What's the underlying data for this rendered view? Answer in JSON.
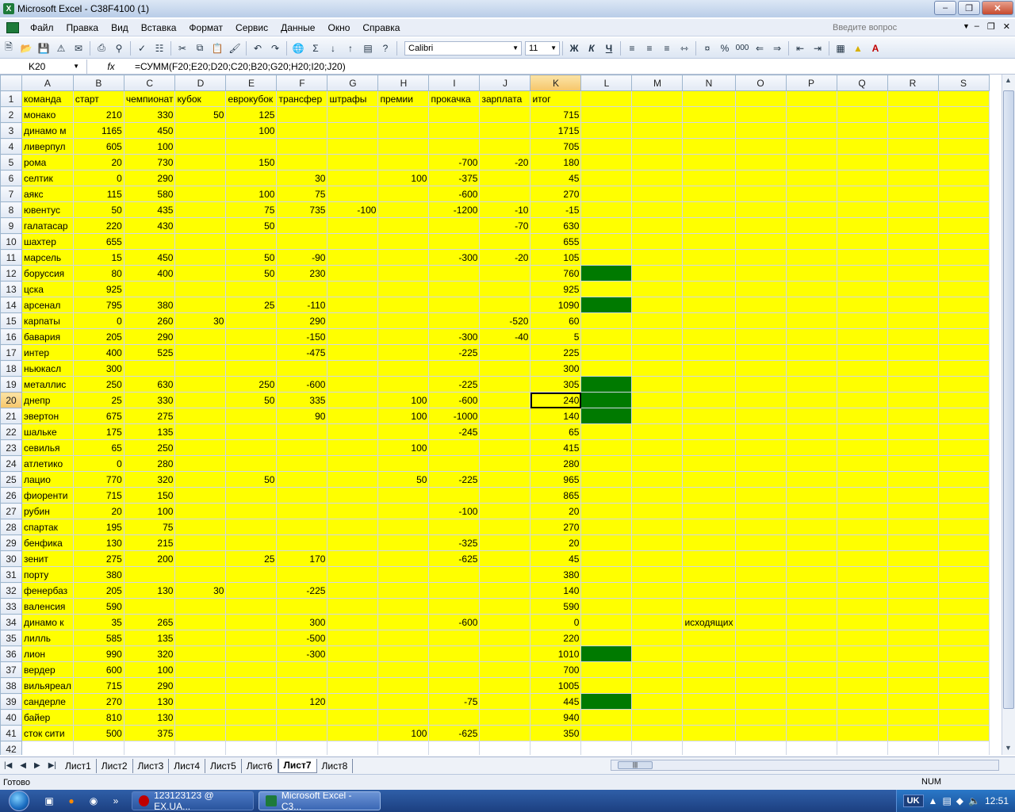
{
  "window": {
    "title": "Microsoft Excel - C38F4100 (1)"
  },
  "menu": [
    "Файл",
    "Правка",
    "Вид",
    "Вставка",
    "Формат",
    "Сервис",
    "Данные",
    "Окно",
    "Справка"
  ],
  "ask_placeholder": "Введите вопрос",
  "toolbar": {
    "font": "Calibri",
    "size": "11",
    "bold": "Ж",
    "italic": "К",
    "underline": "Ч",
    "percent": "%",
    "thousands": "000",
    "sigma": "Σ"
  },
  "formula_bar": {
    "name_box": "K20",
    "fx": "fx",
    "formula": "=СУММ(F20;E20;D20;C20;B20;G20;H20;I20;J20)"
  },
  "columns": [
    "A",
    "B",
    "C",
    "D",
    "E",
    "F",
    "G",
    "H",
    "I",
    "J",
    "K",
    "L",
    "M",
    "N",
    "O",
    "P",
    "Q",
    "R",
    "S"
  ],
  "rows": [
    [
      "команда",
      "старт",
      "чемпионат",
      "кубок",
      "еврокубок",
      "трансфер",
      "штрафы",
      "премии",
      "прокачка",
      "зарплата",
      "итог"
    ],
    [
      "монако",
      "210",
      "330",
      "50",
      "125",
      "",
      "",
      "",
      "",
      "",
      "715"
    ],
    [
      "динамо м",
      "1165",
      "450",
      "",
      "100",
      "",
      "",
      "",
      "",
      "",
      "1715"
    ],
    [
      "ливерпул",
      "605",
      "100",
      "",
      "",
      "",
      "",
      "",
      "",
      "",
      "705"
    ],
    [
      "рома",
      "20",
      "730",
      "",
      "150",
      "",
      "",
      "",
      "-700",
      "-20",
      "180"
    ],
    [
      "селтик",
      "0",
      "290",
      "",
      "",
      "30",
      "",
      "100",
      "-375",
      "",
      "45"
    ],
    [
      "аякс",
      "115",
      "580",
      "",
      "100",
      "75",
      "",
      "",
      "-600",
      "",
      "270"
    ],
    [
      "ювентус",
      "50",
      "435",
      "",
      "75",
      "735",
      "-100",
      "",
      "-1200",
      "-10",
      "-15"
    ],
    [
      "галатасар",
      "220",
      "430",
      "",
      "50",
      "",
      "",
      "",
      "",
      "-70",
      "630"
    ],
    [
      "шахтер",
      "655",
      "",
      "",
      "",
      "",
      "",
      "",
      "",
      "",
      "655"
    ],
    [
      "марсель",
      "15",
      "450",
      "",
      "50",
      "-90",
      "",
      "",
      "-300",
      "-20",
      "105"
    ],
    [
      "боруссия",
      "80",
      "400",
      "",
      "50",
      "230",
      "",
      "",
      "",
      "",
      "760"
    ],
    [
      "цска",
      "925",
      "",
      "",
      "",
      "",
      "",
      "",
      "",
      "",
      "925"
    ],
    [
      "арсенал",
      "795",
      "380",
      "",
      "25",
      "-110",
      "",
      "",
      "",
      "",
      "1090"
    ],
    [
      "карпаты",
      "0",
      "260",
      "30",
      "",
      "290",
      "",
      "",
      "",
      "-520",
      "60"
    ],
    [
      "бавария",
      "205",
      "290",
      "",
      "",
      "-150",
      "",
      "",
      "-300",
      "-40",
      "5"
    ],
    [
      "интер",
      "400",
      "525",
      "",
      "",
      "-475",
      "",
      "",
      "-225",
      "",
      "225"
    ],
    [
      "ньюкасл",
      "300",
      "",
      "",
      "",
      "",
      "",
      "",
      "",
      "",
      "300"
    ],
    [
      "металлис",
      "250",
      "630",
      "",
      "250",
      "-600",
      "",
      "",
      "-225",
      "",
      "305"
    ],
    [
      "днепр",
      "25",
      "330",
      "",
      "50",
      "335",
      "",
      "100",
      "-600",
      "",
      "240"
    ],
    [
      "эвертон",
      "675",
      "275",
      "",
      "",
      "90",
      "",
      "100",
      "-1000",
      "",
      "140"
    ],
    [
      "шальке",
      "175",
      "135",
      "",
      "",
      "",
      "",
      "",
      "-245",
      "",
      "65"
    ],
    [
      "севилья",
      "65",
      "250",
      "",
      "",
      "",
      "",
      "100",
      "",
      "",
      "415"
    ],
    [
      "атлетико",
      "0",
      "280",
      "",
      "",
      "",
      "",
      "",
      "",
      "",
      "280"
    ],
    [
      "лацио",
      "770",
      "320",
      "",
      "50",
      "",
      "",
      "50",
      "-225",
      "",
      "965"
    ],
    [
      "фиоренти",
      "715",
      "150",
      "",
      "",
      "",
      "",
      "",
      "",
      "",
      "865"
    ],
    [
      "рубин",
      "20",
      "100",
      "",
      "",
      "",
      "",
      "",
      "-100",
      "",
      "20"
    ],
    [
      "спартак",
      "195",
      "75",
      "",
      "",
      "",
      "",
      "",
      "",
      "",
      "270"
    ],
    [
      "бенфика",
      "130",
      "215",
      "",
      "",
      "",
      "",
      "",
      "-325",
      "",
      "20"
    ],
    [
      "зенит",
      "275",
      "200",
      "",
      "25",
      "170",
      "",
      "",
      "-625",
      "",
      "45"
    ],
    [
      "порту",
      "380",
      "",
      "",
      "",
      "",
      "",
      "",
      "",
      "",
      "380"
    ],
    [
      "фенербаз",
      "205",
      "130",
      "30",
      "",
      "-225",
      "",
      "",
      "",
      "",
      "140"
    ],
    [
      "валенсия",
      "590",
      "",
      "",
      "",
      "",
      "",
      "",
      "",
      "",
      "590"
    ],
    [
      "динамо к",
      "35",
      "265",
      "",
      "",
      "300",
      "",
      "",
      "-600",
      "",
      "0"
    ],
    [
      "лилль",
      "585",
      "135",
      "",
      "",
      "-500",
      "",
      "",
      "",
      "",
      "220"
    ],
    [
      "лион",
      "990",
      "320",
      "",
      "",
      "-300",
      "",
      "",
      "",
      "",
      "1010"
    ],
    [
      "вердер",
      "600",
      "100",
      "",
      "",
      "",
      "",
      "",
      "",
      "",
      "700"
    ],
    [
      "вильяреал",
      "715",
      "290",
      "",
      "",
      "",
      "",
      "",
      "",
      "",
      "1005"
    ],
    [
      "сандерле",
      "270",
      "130",
      "",
      "",
      "120",
      "",
      "",
      "-75",
      "",
      "445"
    ],
    [
      "байер",
      "810",
      "130",
      "",
      "",
      "",
      "",
      "",
      "",
      "",
      "940"
    ],
    [
      "сток сити",
      "500",
      "375",
      "",
      "",
      "",
      "",
      "100",
      "-625",
      "",
      "350"
    ]
  ],
  "green_l_rows": [
    12,
    14,
    19,
    20,
    21,
    36,
    39
  ],
  "note": {
    "row": 34,
    "text": "исходящих"
  },
  "selected_cell": {
    "row": 20,
    "col": "K"
  },
  "sheet_tabs": [
    "Лист1",
    "Лист2",
    "Лист3",
    "Лист4",
    "Лист5",
    "Лист6",
    "Лист7",
    "Лист8"
  ],
  "active_tab": "Лист7",
  "status": {
    "left": "Готово",
    "num": "NUM"
  },
  "taskbar": {
    "tasks": [
      {
        "label": "123123123 @ EX.UA..."
      },
      {
        "label": "Microsoft Excel - C3..."
      }
    ],
    "lang": "UK",
    "clock": "12:51"
  },
  "colors": {
    "yellow": "#ffff00",
    "green": "#007a00"
  }
}
